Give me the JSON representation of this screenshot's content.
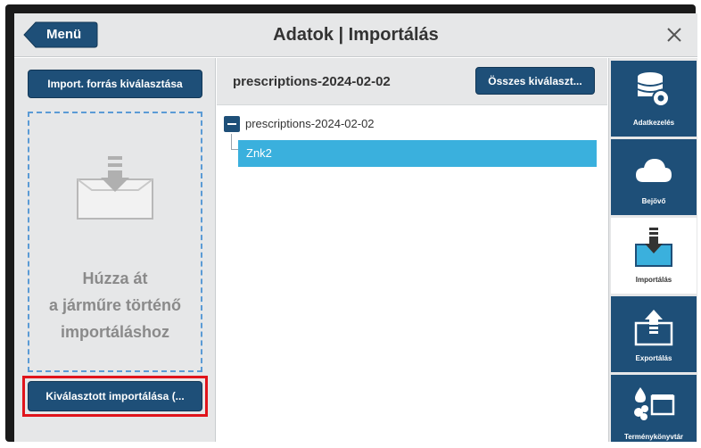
{
  "header": {
    "menu_label": "Menü",
    "title": "Adatok | Importálás",
    "close_icon": "close-icon"
  },
  "left_panel": {
    "import_source_label": "Import. forrás kiválasztása",
    "drop_text_line1": "Húzza át",
    "drop_text_line2": "a járműre történő",
    "drop_text_line3": "importáláshoz",
    "drop_icon": "drop-import-icon",
    "import_selected_label": "Kiválasztott importálása (..."
  },
  "main": {
    "folder_title": "prescriptions-2024-02-02",
    "select_all_label": "Összes kiválaszt...",
    "tree": {
      "root_label": "prescriptions-2024-02-02",
      "child_label": "Znk2"
    }
  },
  "sidebar": {
    "items": [
      {
        "label": "Adatkezelés",
        "icon": "data-management-icon",
        "active": false
      },
      {
        "label": "Bejövő",
        "icon": "cloud-icon",
        "active": false
      },
      {
        "label": "Importálás",
        "icon": "import-icon",
        "active": true
      },
      {
        "label": "Exportálás",
        "icon": "export-icon",
        "active": false
      },
      {
        "label": "Terménykönyvtár",
        "icon": "crop-library-icon",
        "active": false
      }
    ]
  },
  "colors": {
    "primary": "#1e4f78",
    "selection": "#3ab0dd",
    "highlight": "#e0141b",
    "panel": "#e6e7e8"
  }
}
